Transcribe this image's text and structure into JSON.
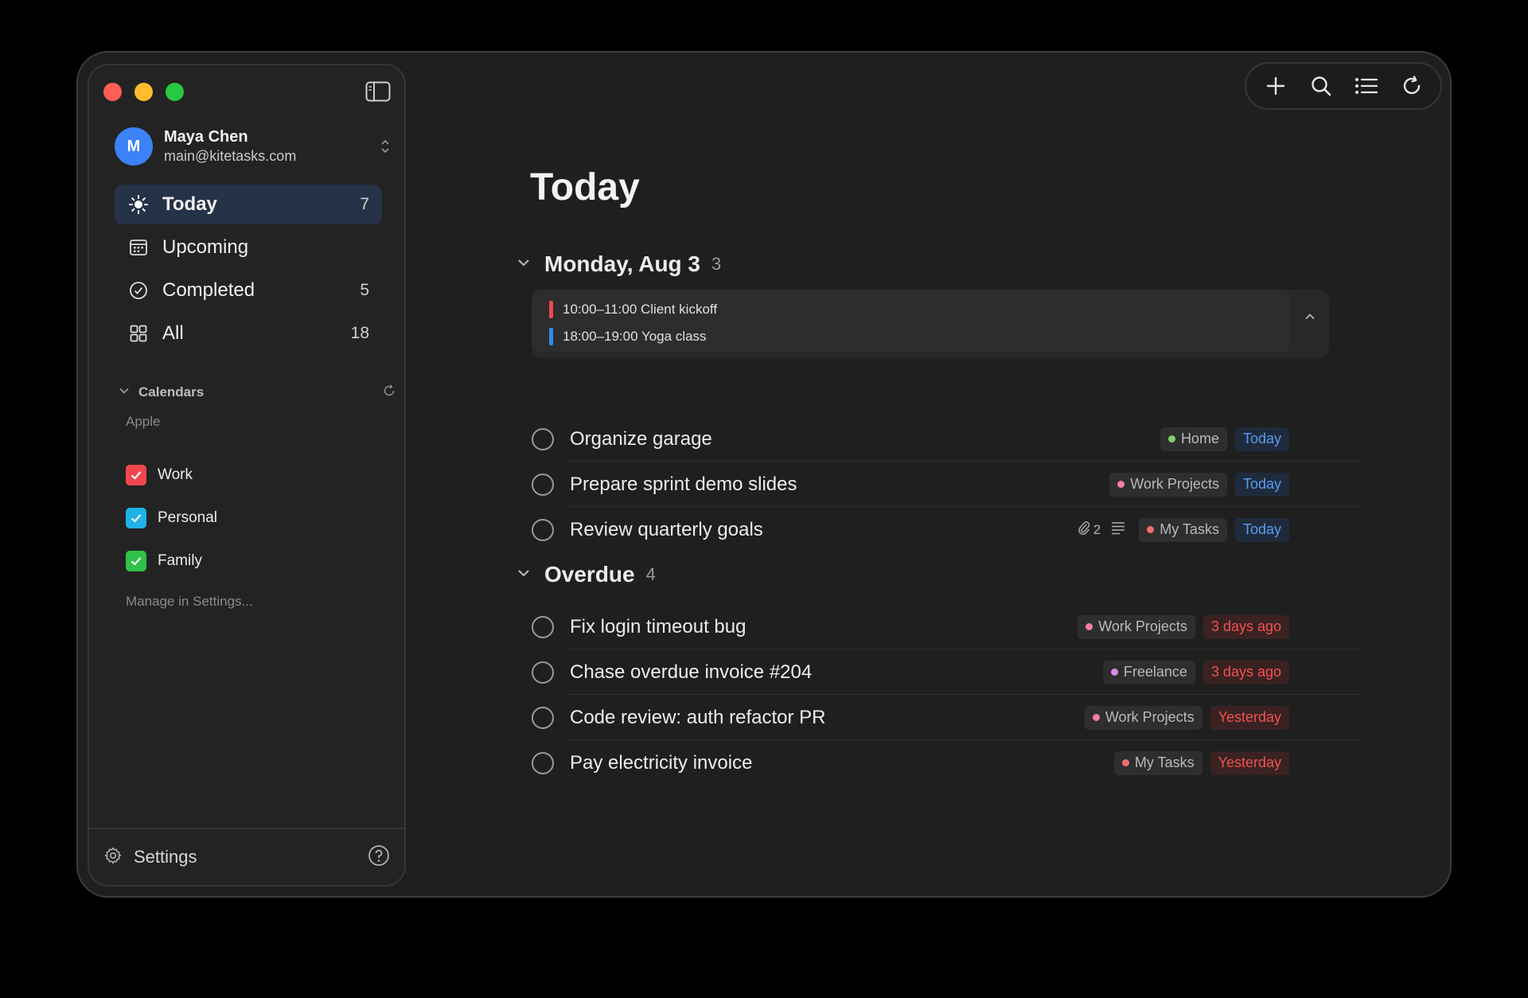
{
  "account": {
    "initial": "M",
    "name": "Maya Chen",
    "email": "main@kitetasks.com"
  },
  "nav": [
    {
      "label": "Today",
      "count": "7",
      "icon": "sun-icon"
    },
    {
      "label": "Upcoming",
      "count": "",
      "icon": "calendar-icon"
    },
    {
      "label": "Completed",
      "count": "5",
      "icon": "check-circle-icon"
    },
    {
      "label": "All",
      "count": "18",
      "icon": "grid-icon"
    }
  ],
  "calendars": {
    "header": "Calendars",
    "group": "Apple",
    "items": [
      {
        "label": "Work",
        "color": "#f0474f"
      },
      {
        "label": "Personal",
        "color": "#1fb2e8"
      },
      {
        "label": "Family",
        "color": "#2ec24a"
      }
    ],
    "manage": "Manage in Settings..."
  },
  "footer": {
    "settings_label": "Settings"
  },
  "page": {
    "title": "Today"
  },
  "sections": [
    {
      "name": "Monday, Aug 3",
      "count": "3"
    },
    {
      "name": "Overdue",
      "count": "4"
    }
  ],
  "events": [
    {
      "text": "10:00–11:00 Client kickoff",
      "color": "#f0474f"
    },
    {
      "text": "18:00–19:00 Yoga class",
      "color": "#2f8cf0"
    }
  ],
  "tasks_today": [
    {
      "title": "Organize garage",
      "tag": "Home",
      "tag_color": "#7fd06a",
      "date": "Today"
    },
    {
      "title": "Prepare sprint demo slides",
      "tag": "Work Projects",
      "tag_color": "#f57ba8",
      "date": "Today"
    },
    {
      "title": "Review quarterly goals",
      "attachments": "2",
      "tag": "My Tasks",
      "tag_color": "#f26d6d",
      "date": "Today"
    }
  ],
  "tasks_overdue": [
    {
      "title": "Fix login timeout bug",
      "tag": "Work Projects",
      "tag_color": "#f57ba8",
      "date": "3 days ago"
    },
    {
      "title": "Chase overdue invoice #204",
      "tag": "Freelance",
      "tag_color": "#d98ce8",
      "date": "3 days ago"
    },
    {
      "title": "Code review: auth refactor PR",
      "tag": "Work Projects",
      "tag_color": "#f57ba8",
      "date": "Yesterday"
    },
    {
      "title": "Pay electricity invoice",
      "tag": "My Tasks",
      "tag_color": "#f26d6d",
      "date": "Yesterday"
    }
  ],
  "colors": {
    "accent": "#3b82f6",
    "today_date": "#5b9bf0",
    "overdue_date": "#f05252"
  }
}
